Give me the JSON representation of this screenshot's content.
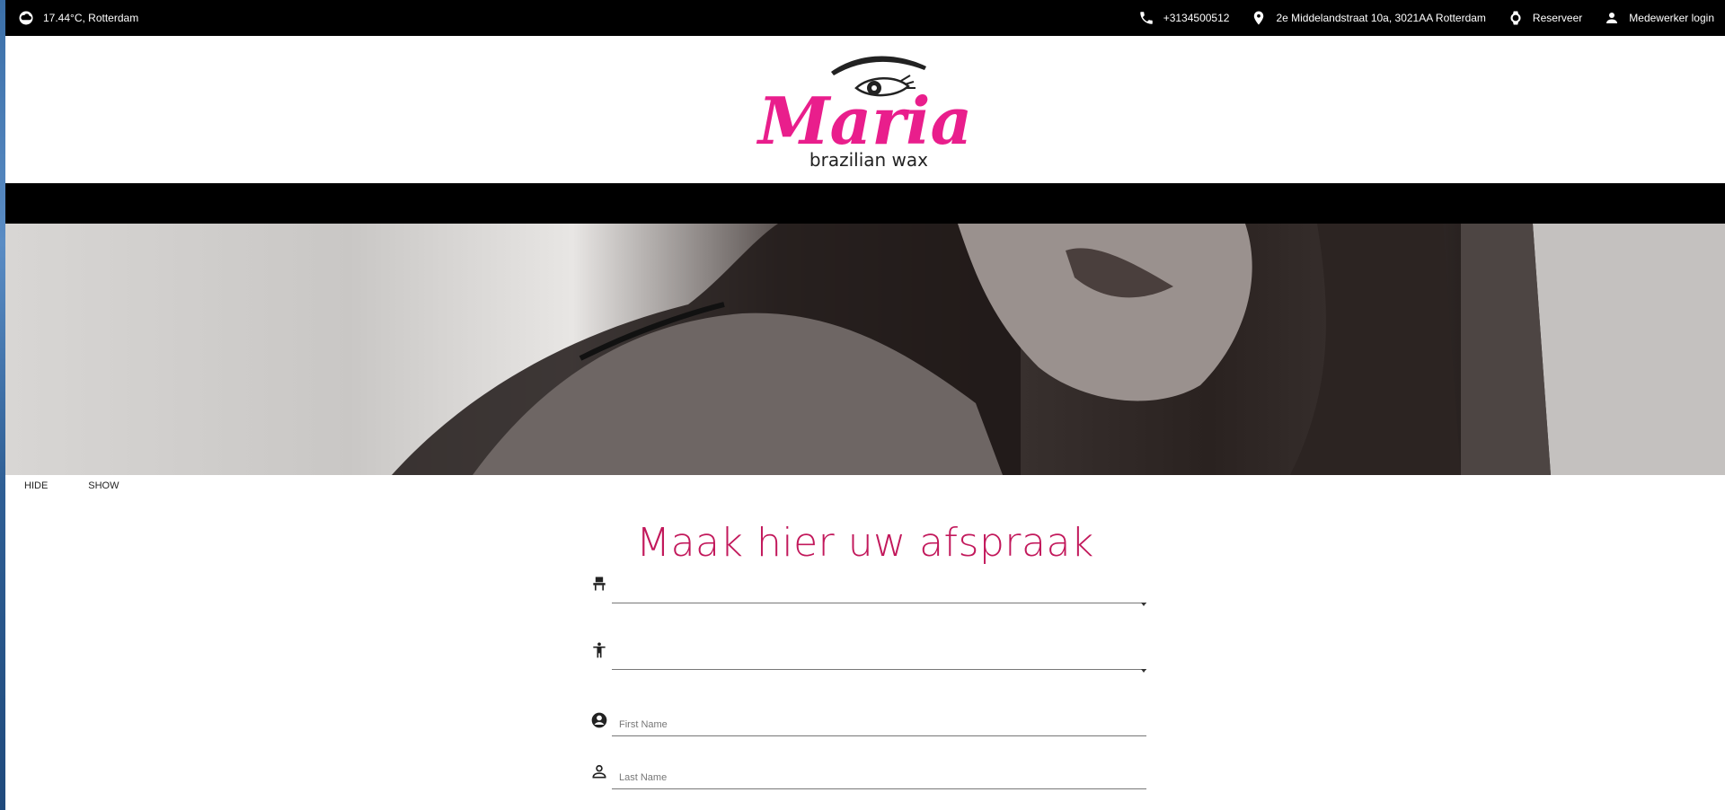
{
  "topbar": {
    "weather": "17.44°C, Rotterdam",
    "phone": "+3134500512",
    "address": "2e Middelandstraat 10a, 3021AA Rotterdam",
    "reserve": "Reserveer",
    "login": "Medewerker login"
  },
  "logo": {
    "name": "Maria",
    "tagline": "brazilian wax",
    "brand_color": "#e91e8c"
  },
  "toggles": {
    "hide": "HIDE",
    "show": "SHOW"
  },
  "form": {
    "title": "Maak hier uw afspraak",
    "title_color": "#c2185b",
    "first_name_placeholder": "First Name",
    "last_name_placeholder": "Last Name"
  }
}
